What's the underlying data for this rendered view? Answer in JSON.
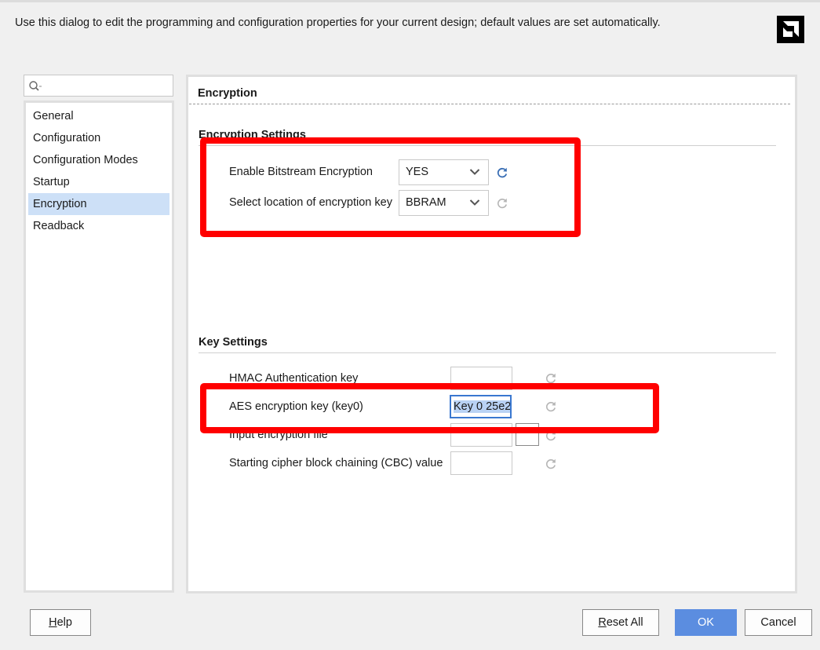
{
  "description": "Use this dialog to edit the programming and configuration properties for your current design; default values are set automatically.",
  "logo_icon": "amd-logo",
  "search": {
    "value": "",
    "icon": "search-icon"
  },
  "nav": {
    "items": [
      {
        "label": "General"
      },
      {
        "label": "Configuration"
      },
      {
        "label": "Configuration Modes"
      },
      {
        "label": "Startup"
      },
      {
        "label": "Encryption",
        "selected": true
      },
      {
        "label": "Readback"
      }
    ]
  },
  "page": {
    "title": "Encryption",
    "encryption_settings": {
      "title": "Encryption Settings",
      "rows": [
        {
          "label": "Enable Bitstream Encryption",
          "value": "YES",
          "refresh_active": true
        },
        {
          "label": "Select location of encryption key",
          "value": "BBRAM",
          "refresh_active": false
        }
      ]
    },
    "key_settings": {
      "title": "Key Settings",
      "rows": [
        {
          "label": "HMAC Authentication key",
          "value": ""
        },
        {
          "label": "AES encryption key (key0)",
          "value": "Key 0 25e2"
        },
        {
          "label": "Input encryption file",
          "value": "",
          "browse_label": "···"
        },
        {
          "label": "Starting cipher block chaining (CBC) value",
          "value": ""
        }
      ]
    }
  },
  "colors": {
    "highlight": "#ff0000",
    "selected_nav": "#cde0f7",
    "primary_button": "#5b8de0",
    "refresh_active": "#3a6fb5",
    "refresh_inactive": "#b5b5b5"
  },
  "buttons": {
    "help": {
      "mnemonic": "H",
      "rest": "elp"
    },
    "reset_all": {
      "mnemonic": "R",
      "rest": "eset All"
    },
    "ok": "OK",
    "cancel": "Cancel"
  }
}
